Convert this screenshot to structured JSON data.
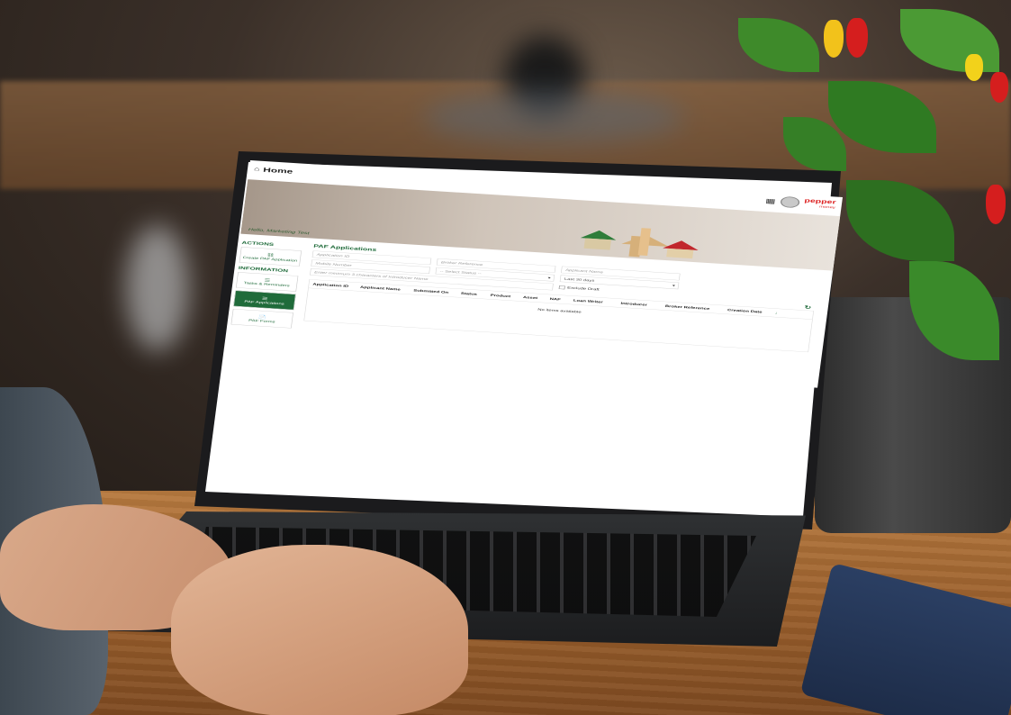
{
  "header": {
    "title": "Home"
  },
  "brand": {
    "name": "pepper",
    "sub": "money"
  },
  "banner": {
    "greeting": "Hello, Marketing Test"
  },
  "sidebar": {
    "actions_heading": "ACTIONS",
    "information_heading": "INFORMATION",
    "items": [
      {
        "label": "Create PAF Application",
        "icon": "car-icon"
      },
      {
        "label": "Tasks & Reminders",
        "icon": "list-icon"
      },
      {
        "label": "PAF Applications",
        "icon": "list-icon"
      },
      {
        "label": "PAF Forms",
        "icon": "document-icon"
      }
    ]
  },
  "main": {
    "title": "PAF Applications",
    "filters": {
      "application_id": "Application ID",
      "broker_reference": "Broker Reference",
      "applicant_name": "Applicant Name",
      "mobile_number": "Mobile Number",
      "select_status": "-- Select Status --",
      "date_range": "Last 30 days",
      "introducer": "Enter minimum 3 characters of Introducer Name",
      "exclude_draft": "Exclude Draft"
    },
    "table": {
      "columns": [
        "Application ID",
        "Applicant Name",
        "Submitted On",
        "Status",
        "Product",
        "Asset",
        "NAF",
        "Loan Writer",
        "Introducer",
        "Broker Reference",
        "Creation Date"
      ],
      "empty": "No items available"
    }
  },
  "colors": {
    "accent": "#1f6b3a",
    "brand": "#d22222"
  }
}
